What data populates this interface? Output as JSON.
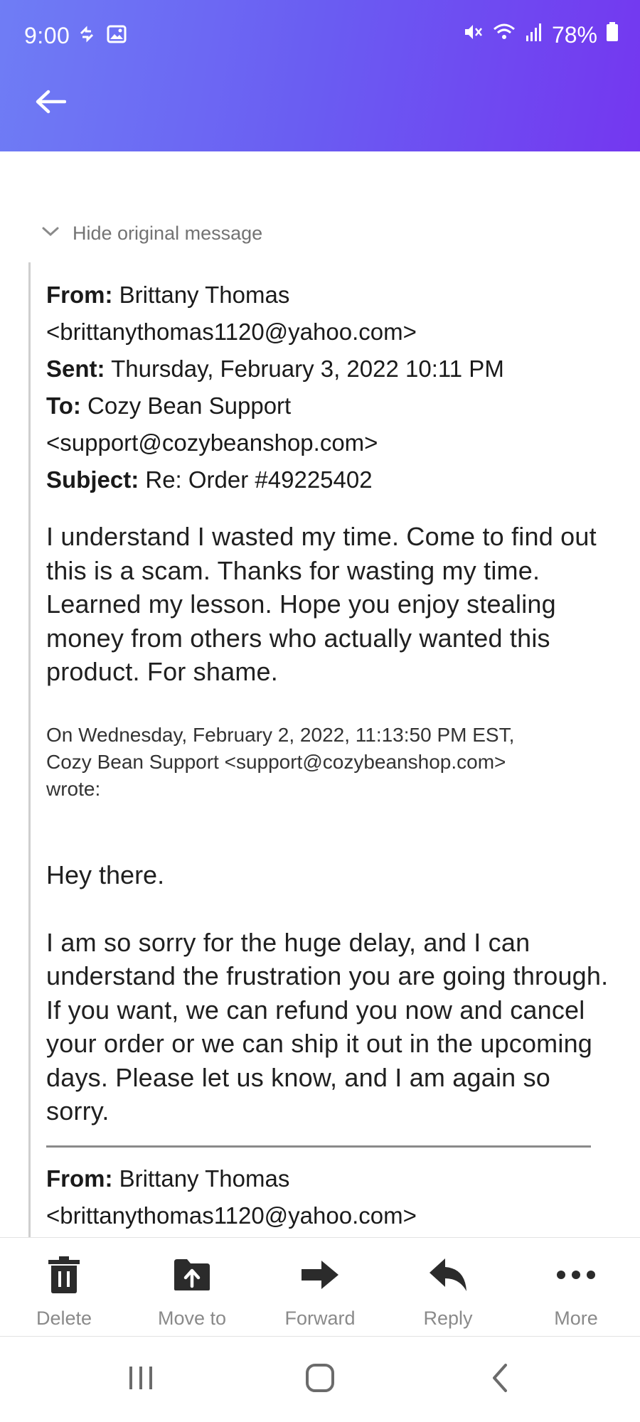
{
  "status_bar": {
    "time": "9:00",
    "battery": "78%",
    "icons": [
      "sync-icon",
      "image-icon",
      "mute-icon",
      "wifi-icon",
      "signal-icon",
      "battery-icon"
    ]
  },
  "app_bar": {
    "back_icon": "arrow-left-icon"
  },
  "toggle": {
    "label": "Hide original message",
    "icon": "chevron-down-icon"
  },
  "original_message": {
    "from_label": "From:",
    "from_name": "Brittany Thomas",
    "from_email": "<brittanythomas1120@yahoo.com>",
    "sent_label": "Sent:",
    "sent_value": "Thursday, February 3, 2022 10:11 PM",
    "to_label": "To:",
    "to_name": "Cozy Bean Support",
    "to_email": "<support@cozybeanshop.com>",
    "subject_label": "Subject:",
    "subject_value": "Re: Order #49225402",
    "body": "I understand I wasted my time. Come to find out this is a scam. Thanks for wasting my time. Learned my lesson. Hope you enjoy stealing money from others who actually wanted this product. For shame.",
    "attribution_line1": "On Wednesday, February 2, 2022, 11:13:50 PM EST,",
    "attribution_line2": "Cozy Bean Support <support@cozybeanshop.com>",
    "attribution_line3": "wrote:",
    "reply_greeting": "Hey there.",
    "reply_body": "I am so sorry for the huge delay, and I can understand the frustration you are going through. If you want, we can refund you now and cancel your order or we can ship it out in the upcoming days. Please let us know, and I am again so sorry.",
    "next_from_label": "From:",
    "next_from_name": "Brittany Thomas",
    "next_from_email": "<brittanythomas1120@yahoo.com>"
  },
  "actions": {
    "delete": "Delete",
    "move_to": "Move to",
    "forward": "Forward",
    "reply": "Reply",
    "more": "More"
  },
  "colors": {
    "header_gradient_start": "#6f7df5",
    "header_gradient_end": "#7437f0",
    "action_icon": "#2b2b2b",
    "action_label": "#8a8a8a"
  }
}
